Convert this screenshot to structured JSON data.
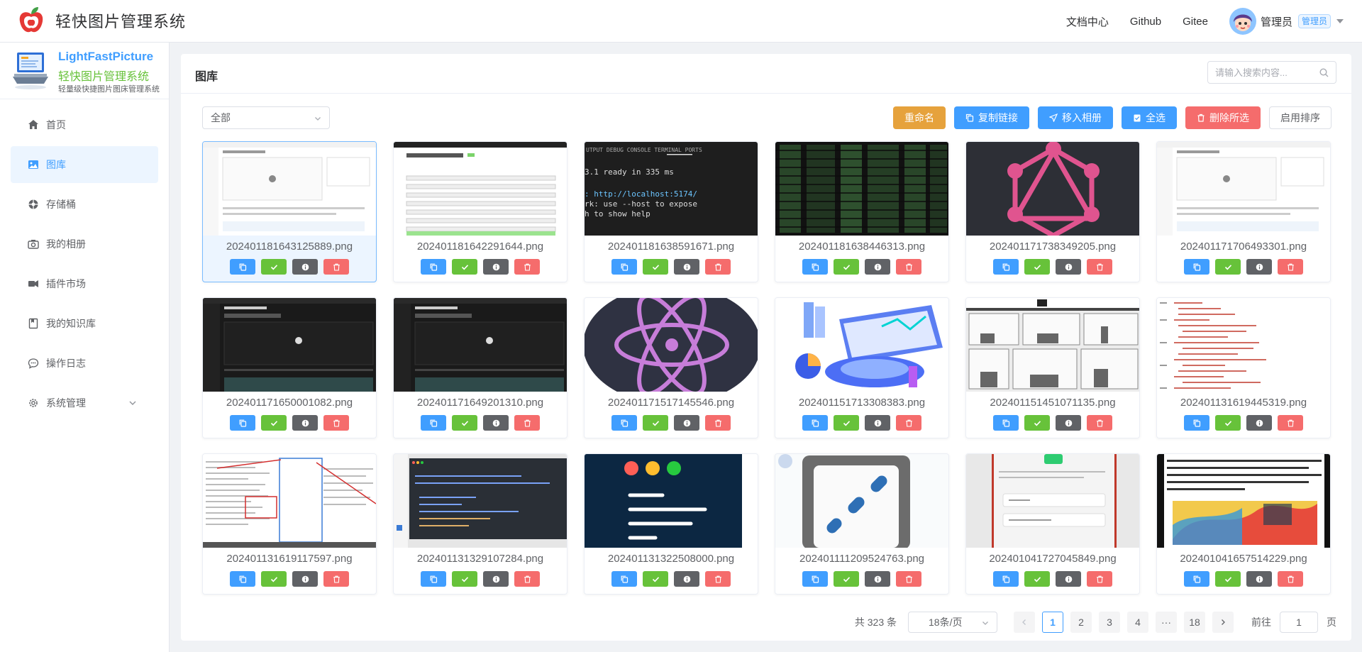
{
  "header": {
    "title": "轻快图片管理系统",
    "nav": [
      "文档中心",
      "Github",
      "Gitee"
    ],
    "user": {
      "name": "管理员",
      "role": "管理员"
    }
  },
  "sidebar": {
    "brand_en": "LightFastPicture",
    "brand_cn": "轻快图片管理系统",
    "brand_sub": "轻量级快捷图片图床管理系统",
    "items": [
      {
        "label": "首页",
        "icon": "home-icon"
      },
      {
        "label": "图库",
        "icon": "picture-icon",
        "active": true
      },
      {
        "label": "存储桶",
        "icon": "bucket-icon"
      },
      {
        "label": "我的相册",
        "icon": "camera-icon"
      },
      {
        "label": "插件市场",
        "icon": "plugin-icon"
      },
      {
        "label": "我的知识库",
        "icon": "book-icon"
      },
      {
        "label": "操作日志",
        "icon": "chat-icon"
      },
      {
        "label": "系统管理",
        "icon": "gear-icon",
        "expandable": true
      }
    ]
  },
  "main": {
    "title": "图库",
    "search_placeholder": "请输入搜索内容...",
    "filter_value": "全部",
    "actions": {
      "rename": "重命名",
      "copy_link": "复制链接",
      "move_album": "移入相册",
      "select_all": "全选",
      "delete_selected": "删除所选",
      "enable_sort": "启用排序"
    }
  },
  "images": [
    {
      "name": "202401181643125889.png",
      "selected": true,
      "preview": "ui-light"
    },
    {
      "name": "202401181642291644.png",
      "preview": "ui-form"
    },
    {
      "name": "202401181638591671.png",
      "preview": "terminal"
    },
    {
      "name": "202401181638446313.png",
      "preview": "matrix"
    },
    {
      "name": "202401171738349205.png",
      "preview": "graphql"
    },
    {
      "name": "202401171706493301.png",
      "preview": "ui-light"
    },
    {
      "name": "202401171650001082.png",
      "preview": "ui-dark"
    },
    {
      "name": "202401171649201310.png",
      "preview": "ui-dark"
    },
    {
      "name": "202401171517145546.png",
      "preview": "atom"
    },
    {
      "name": "202401151713308383.png",
      "preview": "isometric"
    },
    {
      "name": "202401151451071135.png",
      "preview": "rooms"
    },
    {
      "name": "202401131619445319.png",
      "preview": "code-light"
    },
    {
      "name": "202401131619117597.png",
      "preview": "annotated"
    },
    {
      "name": "202401131329107284.png",
      "preview": "code-dark"
    },
    {
      "name": "202401131322508000.png",
      "preview": "mac-window"
    },
    {
      "name": "202401111209524763.png",
      "preview": "blur-logo"
    },
    {
      "name": "202401041727045849.png",
      "preview": "wechat-form"
    },
    {
      "name": "202401041657514229.png",
      "preview": "poster"
    }
  ],
  "pagination": {
    "total_text": "共 323 条",
    "page_size": "18条/页",
    "pages": [
      "1",
      "2",
      "3",
      "4",
      "···",
      "18"
    ],
    "current": "1",
    "goto_label": "前往",
    "goto_value": "1",
    "page_suffix": "页"
  },
  "colors": {
    "primary": "#409eff",
    "success": "#67c23a",
    "warning": "#e6a23c",
    "danger": "#f56c6c",
    "info": "#606266"
  }
}
